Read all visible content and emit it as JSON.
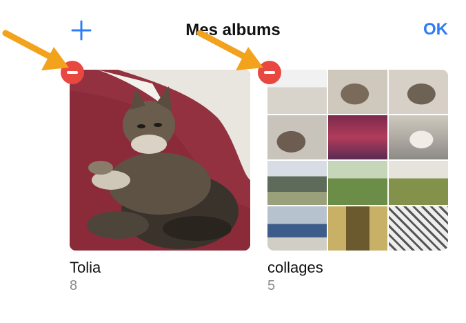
{
  "header": {
    "title": "Mes albums",
    "ok_label": "OK"
  },
  "albums": [
    {
      "name": "Tolia",
      "count": "8"
    },
    {
      "name": "collages",
      "count": "5"
    }
  ],
  "colors": {
    "accent": "#2f7cf6",
    "remove": "#e8483f",
    "annotation_arrow": "#f2a21b",
    "secondary_text": "#8a8a8a"
  },
  "icons": {
    "add": "plus-icon",
    "remove": "minus-circle-icon",
    "annotation": "arrow-icon"
  }
}
